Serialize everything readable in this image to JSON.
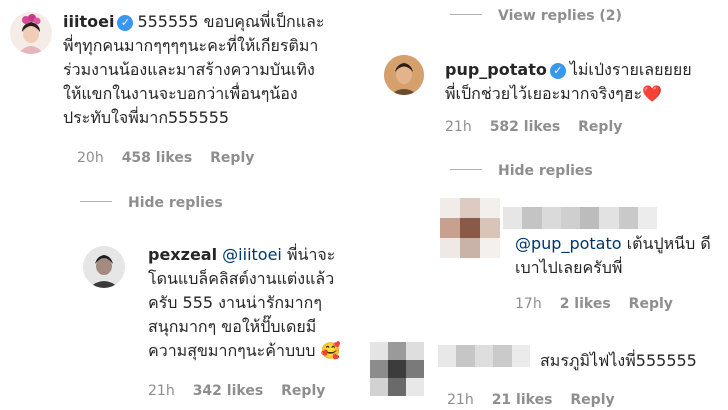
{
  "left": {
    "comment": {
      "username": "iiitoei",
      "lines": [
        "555555 ขอบคุณพี่เป็กและ",
        "พี่ๆทุกคนมากๆๆๆๆนะคะที่ให้เกียรติมา",
        "ร่วมงานน้องและมาสร้างความบันเทิง",
        "ให้แขกในงานจะบอกว่าเพื่อนๆน้อง",
        "ประทับใจพี่มาก555555"
      ],
      "time": "20h",
      "likes": "458 likes",
      "reply": "Reply"
    },
    "toggle_label": "Hide replies",
    "reply": {
      "username": "pexzeal",
      "mention": "@iiitoei",
      "first_line_rest": "พี่น่าจะ",
      "lines": [
        "โดนแบล็คลิสต์งานแต่งแล้ว",
        "ครับ 555 งานน่ารักมากๆ",
        "สนุกมากๆ ขอให้ปั๊บเดยมี",
        "ความสุขมากๆนะค้าบบบ"
      ],
      "emoji": "🥰",
      "time": "21h",
      "likes": "342 likes",
      "reply": "Reply"
    }
  },
  "right": {
    "view_replies": "View replies (2)",
    "comment": {
      "username": "pup_potato",
      "first_line": "ไม่เป่งรายเลยยยย",
      "second_line": "พี่เป็กช่วยไว้เยอะมากจริงๆฮะ",
      "heart": "❤️",
      "time": "21h",
      "likes": "582 likes",
      "reply": "Reply"
    },
    "toggle_label": "Hide replies",
    "reply1": {
      "mention": "@pup_potato",
      "first_line_rest": "เต้นปูหนีบ ดี",
      "second_line": "เบาไปเลยครับพี่",
      "time": "17h",
      "likes": "2 likes",
      "reply": "Reply"
    },
    "reply2": {
      "text": "สมรภูมิไฟไงพี่555555",
      "time": "21h",
      "likes": "21 likes",
      "reply": "Reply"
    }
  },
  "colors": {
    "verified": "#3897f0",
    "mention": "#003569",
    "meta": "#8e8e8e",
    "heart": "#ed4956"
  }
}
